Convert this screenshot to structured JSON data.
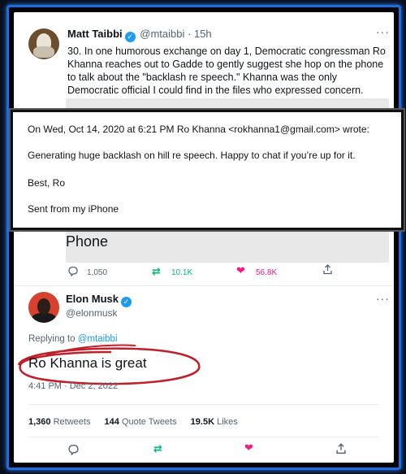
{
  "tweet1": {
    "name": "Matt Taibbi",
    "handle": "@mtaibbi",
    "time": "· 15h",
    "text": "30. In one humorous exchange on day 1, Democratic congressman Ro Khanna reaches out to Gadde to gently suggest she hop on the phone to talk about the \"backlash re speech.\" Khanna was the only Democratic official I could find in the files who expressed concern.",
    "image_text": "Phone",
    "actions": {
      "replies": "1,050",
      "retweets": "10.1K",
      "likes": "56.8K"
    }
  },
  "email": {
    "header": "On Wed, Oct 14, 2020 at 6:21 PM Ro Khanna <rokhanna1@gmail.com> wrote:",
    "body": "Generating huge backlash on hill re speech. Happy to chat if you’re up for it.",
    "signoff": "Best, Ro",
    "footer": "Sent from my iPhone"
  },
  "tweet2": {
    "name": "Elon Musk",
    "handle": "@elonmusk",
    "replying_label": "Replying to",
    "replying_to": "@mtaibbi",
    "text": "Ro Khanna is great",
    "meta": "4:41 PM · Dec 2, 2022",
    "stats": {
      "retweets": "1,360",
      "retweets_label": "Retweets",
      "quotes": "144",
      "quotes_label": "Quote Tweets",
      "likes": "19.5K",
      "likes_label": "Likes"
    }
  },
  "colors": {
    "accent": "#1d9bf0",
    "retweet": "#00ba7c",
    "like": "#f91880",
    "highlight": "#c0202a"
  }
}
